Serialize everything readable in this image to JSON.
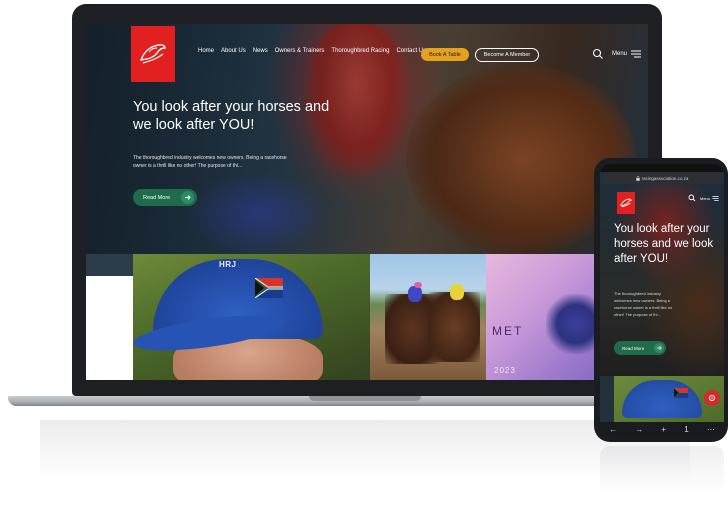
{
  "laptop": {
    "nav": {
      "items": [
        "Home",
        "About Us",
        "News",
        "Owners & Trainers",
        "Thoroughbred Racing",
        "Contact Us"
      ],
      "book_button": "Book A Table",
      "member_button": "Become A Member",
      "menu_label": "Menu"
    },
    "hero": {
      "title": "You look after your horses and we look after YOU!",
      "text": "The thoroughbred industry welcomes new owners. Being a racehorse owner is a thrill like no other! The purpose of thi...",
      "button": "Read More"
    },
    "tiles": {
      "cap_text": "HRJ",
      "met_text": "MET",
      "met_year": "2023"
    }
  },
  "phone": {
    "url": "racingassociation.co.za",
    "menu_label": "Menu",
    "hero": {
      "title": "You look after your horses and we look after YOU!",
      "text": "The thoroughbred industry welcomes new owners. Being a racehorse owner is a thrill like no other! The purpose of thi...",
      "button": "Read More"
    },
    "toolbar": [
      "←",
      "→",
      "+",
      "1",
      "⋯"
    ]
  },
  "colors": {
    "brand_red": "#e2201f",
    "cta_green": "#1f6b4c",
    "book_gold": "#e6a21e"
  },
  "icons": [
    "search-icon",
    "menu-icon",
    "arrow-right-icon",
    "horse-logo-icon",
    "lock-icon",
    "flag-icon",
    "fab-icon"
  ]
}
